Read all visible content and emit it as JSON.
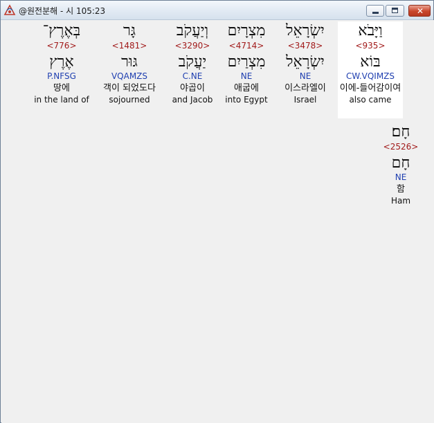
{
  "window": {
    "title": "@원전분해 - 시 105:23"
  },
  "icons": {
    "app": "app-logo-icon",
    "minimize": "minimize-icon",
    "maximize": "maximize-icon",
    "close": "close-icon"
  },
  "words": [
    {
      "hebrew": "וַיָּבֹא",
      "strong": "<935>",
      "lemma": "בּוֹא",
      "morph": "CW.VQIMZS",
      "korean": "이에-들어감이여",
      "english": "also came"
    },
    {
      "hebrew": "יִשְׂרָאֵל",
      "strong": "<3478>",
      "lemma": "יִשְׂרָאֵל",
      "morph": "NE",
      "korean": "이스라엘이",
      "english": "Israel"
    },
    {
      "hebrew": "מִצְרָיִם",
      "strong": "<4714>",
      "lemma": "מִצְרַיִם",
      "morph": "NE",
      "korean": "애굽에",
      "english": "into Egypt"
    },
    {
      "hebrew": "וְיַעֲקֹב",
      "strong": "<3290>",
      "lemma": "יַעֲקֹב",
      "morph": "C.NE",
      "korean": "야곱이",
      "english": "and Jacob"
    },
    {
      "hebrew": "גָּר",
      "strong": "<1481>",
      "lemma": "גּוּר",
      "morph": "VQAMZS",
      "korean": "객이 되었도다",
      "english": "sojourned"
    },
    {
      "hebrew": "בְּאֶרֶץ־",
      "strong": "<776>",
      "lemma": "אֶרֶץ",
      "morph": "P.NFSG",
      "korean": "땅에",
      "english": "in the land of"
    },
    {
      "hebrew": "חָם׃",
      "strong": "<2526>",
      "lemma": "חָם",
      "morph": "NE",
      "korean": "함",
      "english": "Ham"
    }
  ]
}
